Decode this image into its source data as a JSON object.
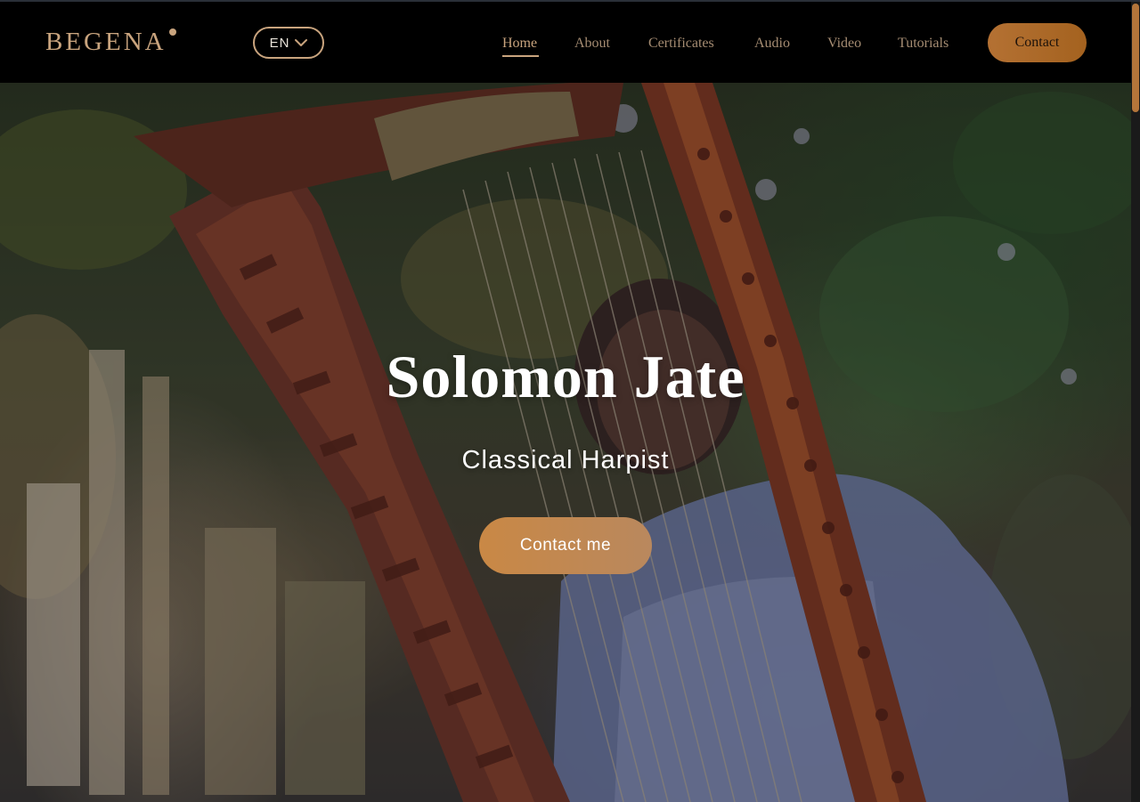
{
  "brand": {
    "logo_text": "BEGENA",
    "accent_color": "#c9a47e",
    "button_color": "#b47133"
  },
  "language_selector": {
    "current": "EN",
    "icon": "chevron-down-icon"
  },
  "nav": {
    "items": [
      {
        "label": "Home",
        "active": true
      },
      {
        "label": "About",
        "active": false
      },
      {
        "label": "Certificates",
        "active": false
      },
      {
        "label": "Audio",
        "active": false
      },
      {
        "label": "Video",
        "active": false
      },
      {
        "label": "Tutorials",
        "active": false
      }
    ],
    "contact_label": "Contact"
  },
  "hero": {
    "title": "Solomon Jate",
    "subtitle": "Classical Harpist",
    "cta_label": "Contact me"
  }
}
